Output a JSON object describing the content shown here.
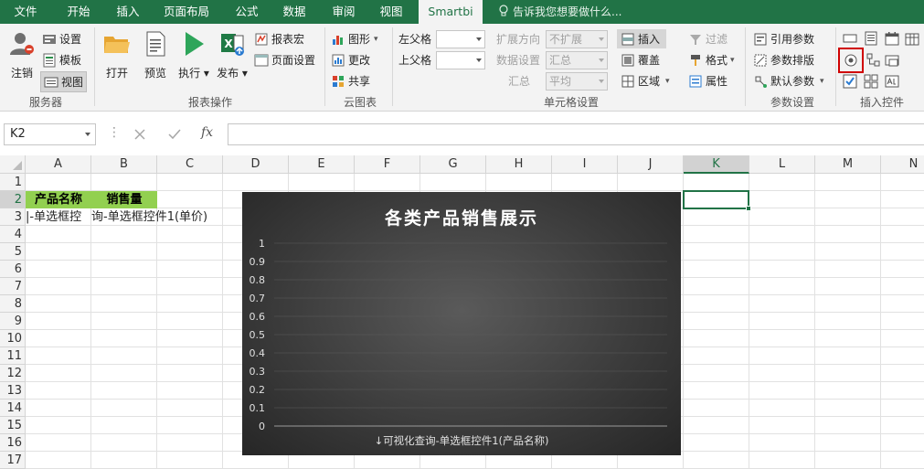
{
  "tabs": [
    {
      "label": "文件",
      "active": false
    },
    {
      "label": "开始",
      "active": false
    },
    {
      "label": "插入",
      "active": false
    },
    {
      "label": "页面布局",
      "active": false
    },
    {
      "label": "公式",
      "active": false
    },
    {
      "label": "数据",
      "active": false
    },
    {
      "label": "审阅",
      "active": false
    },
    {
      "label": "视图",
      "active": false
    },
    {
      "label": "Smartbi",
      "active": true
    }
  ],
  "tellme": "告诉我您想要做什么...",
  "ribbon": {
    "server": {
      "logout": "注销",
      "settings": "设置",
      "template": "模板",
      "view": "视图",
      "group": "服务器"
    },
    "report": {
      "open": "打开",
      "preview": "预览",
      "execute": "执行",
      "publish": "发布",
      "macro": "报表宏",
      "page_setup": "页面设置",
      "group": "报表操作"
    },
    "cloud": {
      "chart": "图形",
      "update": "更改",
      "share": "共享",
      "group": "云图表"
    },
    "cell": {
      "left_parent": "左父格",
      "top_parent": "上父格",
      "expand_dir": "扩展方向",
      "expand_val": "不扩展",
      "data_setting": "数据设置",
      "data_val": "汇总",
      "summary": "汇总",
      "summary_val": "平均",
      "insert": "插入",
      "cover": "覆盖",
      "area": "区域",
      "filter": "过滤",
      "format": "格式",
      "attribute": "属性",
      "group": "单元格设置"
    },
    "param": {
      "ref": "引用参数",
      "layout": "参数排版",
      "default": "默认参数",
      "group": "参数设置"
    },
    "controls": {
      "group": "插入控件"
    }
  },
  "formula": {
    "namebox": "K2",
    "content": ""
  },
  "columns": [
    "A",
    "B",
    "C",
    "D",
    "E",
    "F",
    "G",
    "H",
    "I",
    "J",
    "K",
    "L",
    "M",
    "N"
  ],
  "rows": [
    "1",
    "2",
    "3",
    "4",
    "5",
    "6",
    "7",
    "8",
    "9",
    "10",
    "11",
    "12",
    "13",
    "14",
    "15",
    "16",
    "17"
  ],
  "cells": {
    "A2": "产品名称",
    "B2": "销售量",
    "A3": "|-单选框控",
    "B3": "询-单选框控件1(单价)"
  },
  "chart_data": {
    "type": "bar",
    "title": "各类产品销售展示",
    "xlabel": "↓可视化查询-单选框控件1(产品名称)",
    "ylabel": "",
    "categories": [],
    "values": [],
    "ylim": [
      0,
      1
    ],
    "yticks": [
      "0",
      "0.1",
      "0.2",
      "0.3",
      "0.4",
      "0.5",
      "0.6",
      "0.7",
      "0.8",
      "0.9",
      "1"
    ],
    "grid": true,
    "legend": "none"
  },
  "colors": {
    "excel_green": "#217346",
    "header_fill": "#92d050",
    "highlight_border": "#d00000"
  }
}
